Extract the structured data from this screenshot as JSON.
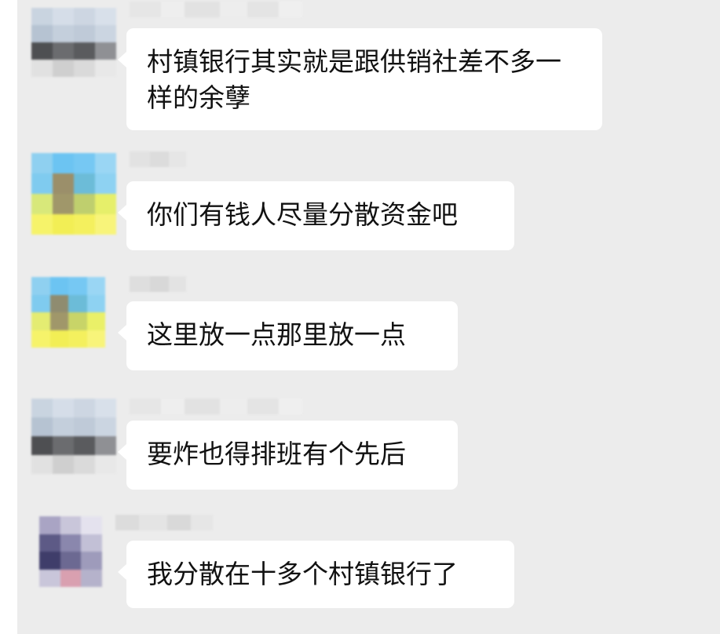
{
  "messages": [
    {
      "id": 1,
      "text": "村镇银行其实就是跟供销社差不多一样的余孽",
      "avatar": "blurred-gray-avatar"
    },
    {
      "id": 2,
      "text": "你们有钱人尽量分散资金吧",
      "avatar": "blurred-blue-yellow-avatar"
    },
    {
      "id": 3,
      "text": "这里放一点那里放一点",
      "avatar": "blurred-blue-yellow-avatar"
    },
    {
      "id": 4,
      "text": "要炸也得排班有个先后",
      "avatar": "blurred-gray-avatar"
    },
    {
      "id": 5,
      "text": "我分散在十多个村镇银行了",
      "avatar": "blurred-purple-avatar"
    }
  ],
  "colors": {
    "background": "#ececec",
    "bubble": "#ffffff",
    "text": "#111111"
  }
}
